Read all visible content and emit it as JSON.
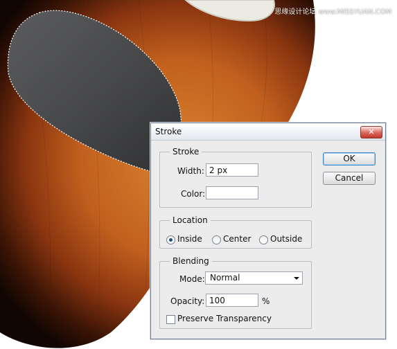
{
  "watermark": "思缘设计论坛  www.MISSYUAN.COM",
  "dialog": {
    "title": "Stroke",
    "close_label": "✕",
    "ok_label": "OK",
    "cancel_label": "Cancel",
    "stroke": {
      "legend": "Stroke",
      "width_label": "Width:",
      "width_value": "2 px",
      "color_label": "Color:",
      "color_value": "#ffffff"
    },
    "location": {
      "legend": "Location",
      "options": [
        "Inside",
        "Center",
        "Outside"
      ],
      "selected": "Inside"
    },
    "blending": {
      "legend": "Blending",
      "mode_label": "Mode:",
      "mode_value": "Normal",
      "opacity_label": "Opacity:",
      "opacity_value": "100",
      "opacity_unit": "%",
      "preserve_label": "Preserve Transparency",
      "preserve_checked": false
    }
  },
  "colors": {
    "guitar_body_center": "#c1601e",
    "guitar_body_edge": "#1b0a03",
    "pickguard": "#4a4b4d",
    "pickguard_cream": "#ecebe3",
    "dialog_bg": "#ececec",
    "radio_fill": "#1f4f86"
  }
}
